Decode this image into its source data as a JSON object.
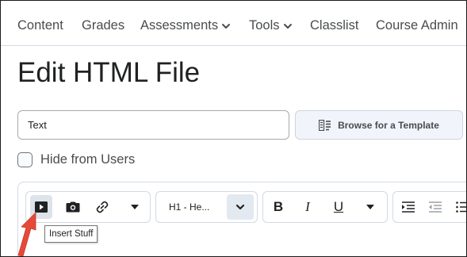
{
  "nav": {
    "items": [
      {
        "label": "Content",
        "dropdown": false
      },
      {
        "label": "Grades",
        "dropdown": false
      },
      {
        "label": "Assessments",
        "dropdown": true
      },
      {
        "label": "Tools",
        "dropdown": true
      },
      {
        "label": "Classlist",
        "dropdown": false
      },
      {
        "label": "Course Admin",
        "dropdown": false
      }
    ]
  },
  "page": {
    "title": "Edit HTML File"
  },
  "form": {
    "title_value": "Text",
    "browse_template_label": "Browse for a Template",
    "hide_from_users_label": "Hide from Users",
    "hide_from_users_checked": false
  },
  "toolbar": {
    "insert_stuff_icon": "play-box-icon",
    "insert_image_icon": "camera-icon",
    "insert_link_icon": "link-icon",
    "format_value": "H1 - He...",
    "bold_label": "B",
    "italic_label": "I",
    "underline_label": "U",
    "tooltip": "Insert Stuff"
  },
  "colors": {
    "accent_arrow": "#e5493a",
    "toolbar_active": "#dde3ea",
    "border": "#d3d9e3"
  }
}
